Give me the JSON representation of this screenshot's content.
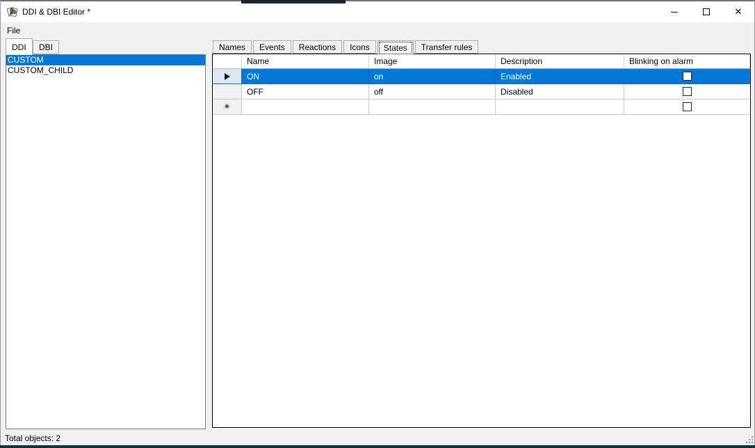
{
  "window": {
    "title": "DDI & DBI Editor *",
    "caption_icons": [
      "minimize-icon",
      "maximize-icon",
      "close-icon"
    ],
    "close_glyph": "✕"
  },
  "menu": {
    "items": [
      {
        "label": "File"
      }
    ]
  },
  "left_panel": {
    "tabs": [
      {
        "label": "DDI",
        "selected": true
      },
      {
        "label": "DBI",
        "selected": false
      }
    ],
    "list": [
      {
        "label": "CUSTOM",
        "selected": true
      },
      {
        "label": "CUSTOM_CHILD",
        "selected": false
      }
    ]
  },
  "right_panel": {
    "tabs": [
      {
        "label": "Names",
        "selected": false
      },
      {
        "label": "Events",
        "selected": false
      },
      {
        "label": "Reactions",
        "selected": false
      },
      {
        "label": "Icons",
        "selected": false
      },
      {
        "label": "States",
        "selected": true
      },
      {
        "label": "Transfer rules",
        "selected": false
      }
    ]
  },
  "grid": {
    "columns": [
      "Name",
      "Image",
      "Description",
      "Blinking on alarm"
    ],
    "rows": [
      {
        "name": "ON",
        "image": "on",
        "description": "Enabled",
        "blinking_on_alarm": false,
        "selected": true,
        "current": true
      },
      {
        "name": "OFF",
        "image": "off",
        "description": "Disabled",
        "blinking_on_alarm": false,
        "selected": false,
        "current": false
      },
      {
        "name": "",
        "image": "",
        "description": "",
        "blinking_on_alarm": false,
        "selected": false,
        "is_new_row": true
      }
    ],
    "new_row_marker": "✱"
  },
  "status_bar": {
    "text": "Total objects: 2"
  },
  "colors": {
    "selection": "#0078d7",
    "selection_text": "#ffffff",
    "titlebar": "#ffffff",
    "chrome_background": "#f0f0f0",
    "grid_border": "#000000",
    "bottom_strip": "#0e3239"
  }
}
